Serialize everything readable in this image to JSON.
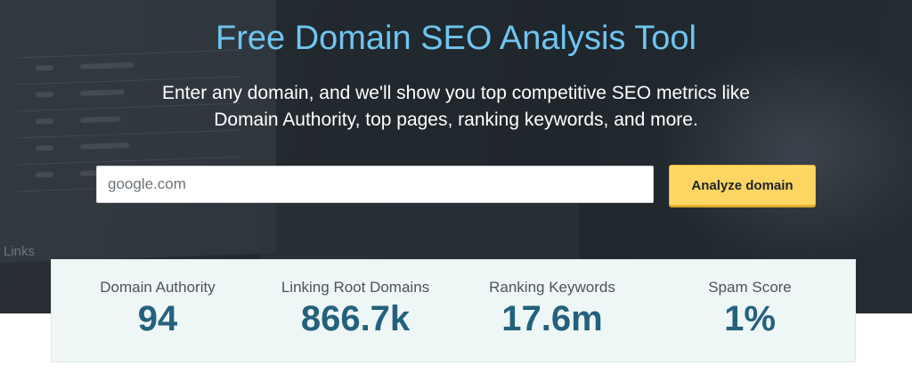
{
  "hero": {
    "title": "Free Domain SEO Analysis Tool",
    "subtitle_line1": "Enter any domain, and we'll show you top competitive SEO metrics like",
    "subtitle_line2": "Domain Authority, top pages, ranking keywords, and more.",
    "background_decor_text": "Links"
  },
  "search": {
    "placeholder": "google.com",
    "value": "",
    "button_label": "Analyze domain"
  },
  "metrics": [
    {
      "label": "Domain Authority",
      "value": "94"
    },
    {
      "label": "Linking Root Domains",
      "value": "866.7k"
    },
    {
      "label": "Ranking Keywords",
      "value": "17.6m"
    },
    {
      "label": "Spam Score",
      "value": "1%"
    }
  ],
  "colors": {
    "title": "#6fc5f0",
    "button": "#fdd563",
    "metric_value": "#24617d",
    "metrics_panel": "#eef6f6"
  }
}
